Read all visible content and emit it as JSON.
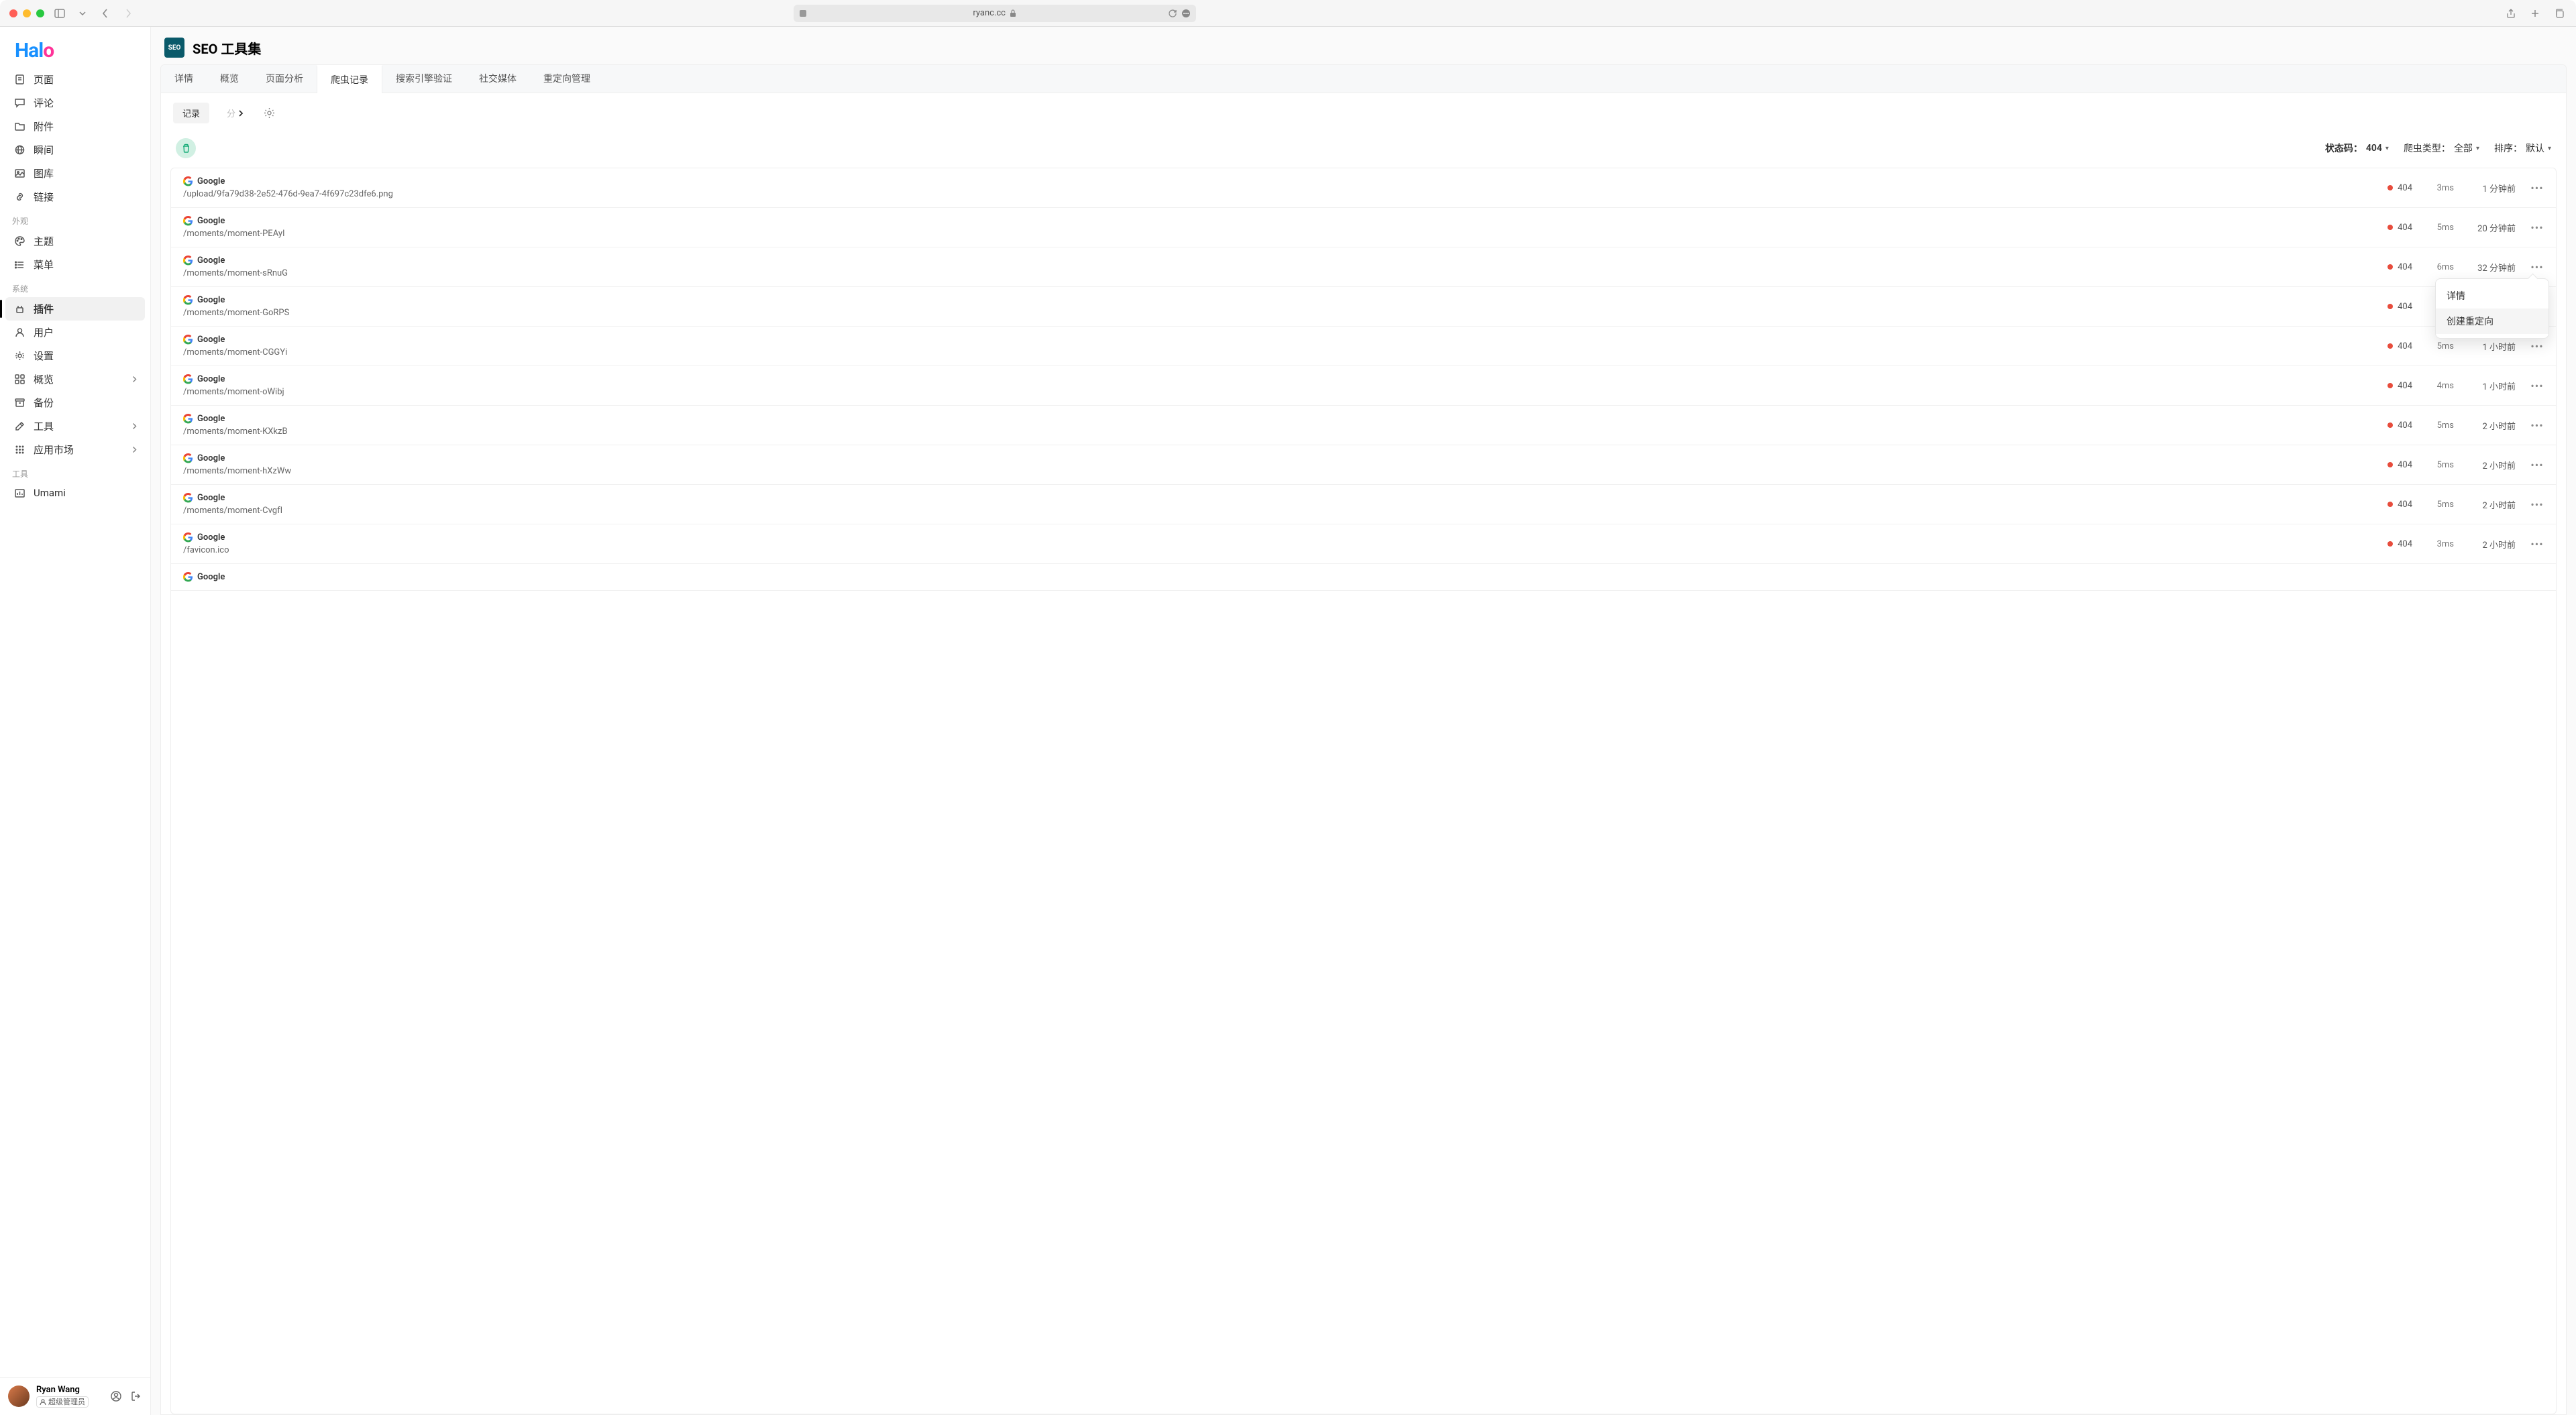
{
  "browser": {
    "url": "ryanc.cc"
  },
  "brand": "Halo",
  "sidebar": {
    "groups": [
      {
        "label": "",
        "items": [
          {
            "icon": "file",
            "label": "页面"
          },
          {
            "icon": "chat",
            "label": "评论"
          },
          {
            "icon": "folder",
            "label": "附件"
          },
          {
            "icon": "globe",
            "label": "瞬间"
          },
          {
            "icon": "image",
            "label": "图库"
          },
          {
            "icon": "link",
            "label": "链接"
          }
        ]
      },
      {
        "label": "外观",
        "items": [
          {
            "icon": "palette",
            "label": "主题"
          },
          {
            "icon": "list",
            "label": "菜单"
          }
        ]
      },
      {
        "label": "系统",
        "items": [
          {
            "icon": "plugin",
            "label": "插件",
            "active": true
          },
          {
            "icon": "user",
            "label": "用户"
          },
          {
            "icon": "gear",
            "label": "设置"
          },
          {
            "icon": "dashboard",
            "label": "概览",
            "chevron": true
          },
          {
            "icon": "archive",
            "label": "备份"
          },
          {
            "icon": "wrench",
            "label": "工具",
            "chevron": true
          },
          {
            "icon": "grid",
            "label": "应用市场",
            "chevron": true
          }
        ]
      },
      {
        "label": "工具",
        "items": [
          {
            "icon": "chart",
            "label": "Umami"
          }
        ]
      }
    ]
  },
  "user": {
    "name": "Ryan Wang",
    "role": "超级管理员"
  },
  "page": {
    "title": "SEO 工具集",
    "icon_text": "SEO"
  },
  "tabs": [
    "详情",
    "概览",
    "页面分析",
    "爬虫记录",
    "搜索引擎验证",
    "社交媒体",
    "重定向管理"
  ],
  "active_tab_index": 3,
  "subtabs": {
    "record": "记录",
    "analysis": "分"
  },
  "filters": {
    "status_label": "状态码：",
    "status_value": "404",
    "type_label": "爬虫类型：",
    "type_value": "全部",
    "sort_label": "排序：",
    "sort_value": "默认"
  },
  "rows": [
    {
      "crawler": "Google",
      "path": "/upload/9fa79d38-2e52-476d-9ea7-4f697c23dfe6.png",
      "code": "404",
      "ms": "3ms",
      "time": "1 分钟前"
    },
    {
      "crawler": "Google",
      "path": "/moments/moment-PEAyI",
      "code": "404",
      "ms": "5ms",
      "time": "20 分钟前"
    },
    {
      "crawler": "Google",
      "path": "/moments/moment-sRnuG",
      "code": "404",
      "ms": "6ms",
      "time": "32 分钟前",
      "popover": true
    },
    {
      "crawler": "Google",
      "path": "/moments/moment-GoRPS",
      "code": "404",
      "ms": "",
      "time": "",
      "blurred": true
    },
    {
      "crawler": "Google",
      "path": "/moments/moment-CGGYi",
      "code": "404",
      "ms": "5ms",
      "time": "1 小时前"
    },
    {
      "crawler": "Google",
      "path": "/moments/moment-oWibj",
      "code": "404",
      "ms": "4ms",
      "time": "1 小时前"
    },
    {
      "crawler": "Google",
      "path": "/moments/moment-KXkzB",
      "code": "404",
      "ms": "5ms",
      "time": "2 小时前"
    },
    {
      "crawler": "Google",
      "path": "/moments/moment-hXzWw",
      "code": "404",
      "ms": "5ms",
      "time": "2 小时前"
    },
    {
      "crawler": "Google",
      "path": "/moments/moment-CvgfI",
      "code": "404",
      "ms": "5ms",
      "time": "2 小时前"
    },
    {
      "crawler": "Google",
      "path": "/favicon.ico",
      "code": "404",
      "ms": "3ms",
      "time": "2 小时前"
    },
    {
      "crawler": "Google",
      "path": "",
      "code": "",
      "ms": "",
      "time": "",
      "partial": true
    }
  ],
  "popover": {
    "detail": "详情",
    "create_redirect": "创建重定向"
  }
}
